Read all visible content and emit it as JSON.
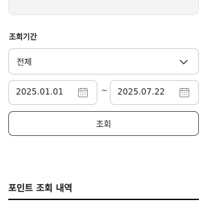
{
  "filter": {
    "period_label": "조회기간",
    "period_select": {
      "selected": "전체",
      "icon": "chevron-down-icon"
    },
    "start_date": "2025.01.01",
    "separator": "~",
    "end_date": "2025.07.22",
    "calendar_icon": "calendar-icon",
    "search_button": "조회"
  },
  "history": {
    "title": "포인트 조회 내역"
  },
  "colors": {
    "border": "#cfcfcf",
    "button_border": "#555555",
    "text": "#222222",
    "top_box_bg": "#f4f4f4"
  }
}
